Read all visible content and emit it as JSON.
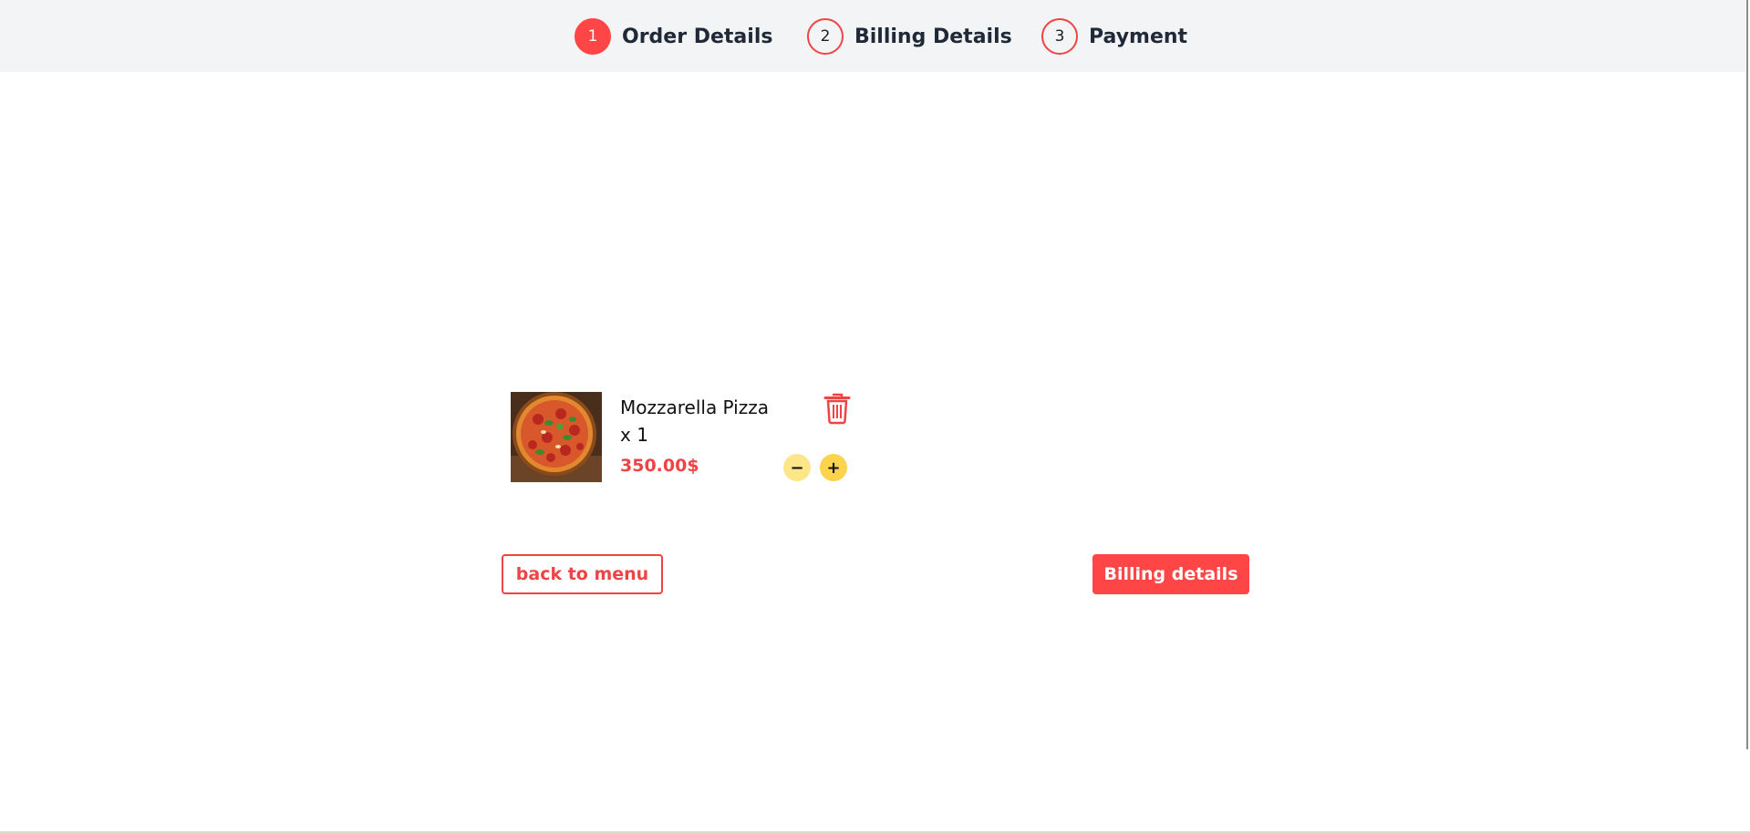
{
  "stepper": {
    "steps": [
      {
        "number": "1",
        "label": "Order Details",
        "active": true
      },
      {
        "number": "2",
        "label": "Billing Details",
        "active": false
      },
      {
        "number": "3",
        "label": "Payment",
        "active": false
      }
    ]
  },
  "cart": {
    "items": [
      {
        "name": "Mozzarella Pizza",
        "quantity_text": "x 1",
        "price": "350.00$",
        "image_icon": "pizza-image"
      }
    ],
    "minus_label": "−",
    "plus_label": "+"
  },
  "actions": {
    "back_label": "back to menu",
    "next_label": "Billing details"
  },
  "colors": {
    "accent": "#ff4646",
    "header_bg": "#f3f4f6",
    "qty_button": "#fcd34d"
  }
}
